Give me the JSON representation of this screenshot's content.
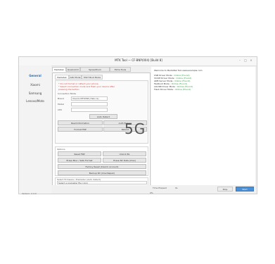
{
  "window": {
    "title": "MTK Tool — CF-BNP(004) [Build 8]"
  },
  "sidebar": {
    "items": [
      {
        "label": "General"
      },
      {
        "label": "Xiaomi"
      },
      {
        "label": "Samsung"
      },
      {
        "label": "Lenovo/Moto"
      }
    ],
    "footer": "Version: 2.4.0"
  },
  "tabs": [
    "Mediatek",
    "Qualcomm",
    "Spreadtrum",
    "Extra Tools"
  ],
  "subtabs": [
    "Mediatek",
    "Adb Mode",
    "FAST Boot Mode"
  ],
  "warnings": [
    "* Do not format or reflash your phone.",
    "* Select connection mode and flash your device after",
    "  pressing the button."
  ],
  "section_label": "Connection Mode",
  "form": {
    "brand_label": "Brand",
    "brand_value": "Xiaomi MT6768 (Helio G)",
    "model_label": "Model",
    "model_value": "",
    "cpu_label": "CPU",
    "cpu_value": ""
  },
  "buttons": {
    "auto_detect": "Auto Detect",
    "read_info": "Read Information",
    "auth_bypass": "Auth Bypass",
    "format_frp": "Format FRP",
    "reboot": "Reboot",
    "reset_frp": "Reset FRP",
    "unlock_bl": "Unlock BL",
    "erase_misc": "Erase Misc / Safe Format",
    "erase_nv": "Erase NV Data (Imei)",
    "backup_nv": "Backup NV (Imei Repair)",
    "factory_reset": "Factory Reset (Xiaomi Account)"
  },
  "qr_text": "5G",
  "group2_label": "Options",
  "group3_label": "Select Firmware / Preloader (Auto detect)",
  "group3_input": "Select a preloader file (.bin)",
  "group3_btn": "Upload Preloader Manually",
  "log": {
    "header": "Welcome to MediaTek Tool www.example.com",
    "lines": [
      {
        "label": "USB Driver Mode :",
        "status": "Online (Found)"
      },
      {
        "label": "VCOM Driver Mode :",
        "status": "Online (Found)"
      },
      {
        "label": "ADB Server Mode :",
        "status": "Online (Found)"
      },
      {
        "label": "Fastboot Mode :",
        "status": "Online (Found)"
      },
      {
        "label": "LibUSB Driver Mode :",
        "status": "Online (Found)"
      },
      {
        "label": "Flash Driver Mode :",
        "status": "Online (Found)"
      }
    ]
  },
  "statusbar": {
    "time_label": "Time Elapsed",
    "time_value": "0s",
    "lp_label": "0%",
    "stop": "Stop",
    "start": "Start"
  }
}
